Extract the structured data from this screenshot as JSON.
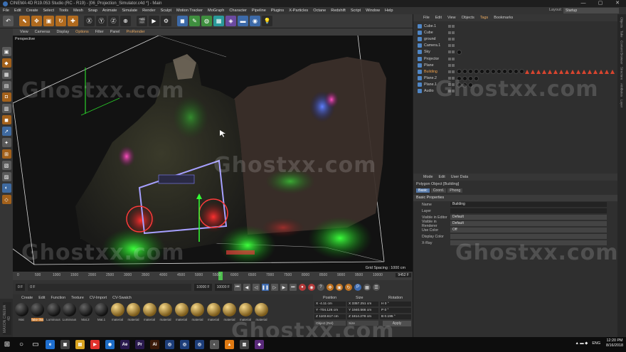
{
  "window": {
    "title": "CINEMA 4D R19.053 Studio (RC - R19) - [06_Projection_Simulator.c4d *] - Main",
    "controls": [
      "—",
      "▢",
      "✕"
    ]
  },
  "menubar": {
    "items": [
      "File",
      "Edit",
      "Create",
      "Select",
      "Tools",
      "Mesh",
      "Snap",
      "Animate",
      "Simulate",
      "Render",
      "Sculpt",
      "Motion Tracker",
      "MoGraph",
      "Character",
      "Pipeline",
      "Plugins",
      "X-Particles",
      "Octane",
      "Redshift",
      "Script",
      "Window",
      "Help"
    ],
    "layout_label": "Layout:",
    "layout_value": "Startup"
  },
  "viewport": {
    "menu": [
      "View",
      "Cameras",
      "Display",
      "Options",
      "Filter",
      "Panel",
      "ProRender"
    ],
    "label": "Perspective",
    "grid_spacing": "Grid Spacing : 1000 cm"
  },
  "timeline": {
    "ticks": [
      "0",
      "500",
      "1000",
      "1500",
      "2000",
      "2500",
      "3000",
      "3500",
      "4000",
      "4500",
      "5000",
      "5500",
      "6000",
      "6500",
      "7000",
      "7500",
      "8000",
      "8500",
      "9000",
      "9500",
      "10000"
    ],
    "end_frame": "9452 F",
    "marker_fraction": 0.565
  },
  "transport": {
    "start": "0 F",
    "current": "0 F",
    "end1": "10000 F",
    "end2": "10000 F"
  },
  "materials": {
    "menu": [
      "Create",
      "Edit",
      "Function",
      "Texture",
      "CV-Import",
      "CV-Swatch"
    ],
    "items": [
      {
        "name": "Mat",
        "type": "dark"
      },
      {
        "name": "Take this",
        "type": "dark",
        "selected": true
      },
      {
        "name": "Luminous",
        "type": "dark"
      },
      {
        "name": "Luminous",
        "type": "dark"
      },
      {
        "name": "Mat.2",
        "type": "dark"
      },
      {
        "name": "Mat.1",
        "type": "dark"
      },
      {
        "name": "material",
        "type": "gold"
      },
      {
        "name": "material",
        "type": "gold"
      },
      {
        "name": "material",
        "type": "gold"
      },
      {
        "name": "material",
        "type": "gold"
      },
      {
        "name": "material",
        "type": "gold"
      },
      {
        "name": "material",
        "type": "gold"
      },
      {
        "name": "material",
        "type": "gold"
      },
      {
        "name": "material",
        "type": "gold"
      },
      {
        "name": "material",
        "type": "gold"
      },
      {
        "name": "material",
        "type": "gold"
      }
    ]
  },
  "coords": {
    "headers": [
      "Position",
      "Size",
      "Rotation"
    ],
    "rows": [
      [
        "X  -4.11 cm",
        "X  3357.251 cm",
        "H  0 °"
      ],
      [
        "Y  -704.126 cm",
        "Y  1940.566 cm",
        "P  0 °"
      ],
      [
        "Z  1103.617 cm",
        "Z  1814.278 cm",
        "B  0.195 °"
      ]
    ],
    "mode1": "Object (Rel)",
    "mode2": "Size",
    "apply": "Apply"
  },
  "objects": {
    "menu": [
      "File",
      "Edit",
      "View",
      "Objects",
      "Tags",
      "Bookmarks"
    ],
    "items": [
      {
        "name": "Cube.1",
        "tags": []
      },
      {
        "name": "Cube",
        "tags": []
      },
      {
        "name": "ground",
        "tags": []
      },
      {
        "name": "Camera.1",
        "tags": []
      },
      {
        "name": "Sky",
        "tags": [
          "dot"
        ]
      },
      {
        "name": "Projector",
        "tags": []
      },
      {
        "name": "Plane",
        "tags": []
      },
      {
        "name": "Building",
        "selected": true,
        "tags": [
          "dot",
          "dot",
          "dot",
          "dot",
          "dot",
          "dot",
          "dot",
          "dot",
          "dot",
          "dot",
          "dot",
          "dot",
          "tri",
          "tri",
          "tri",
          "tri",
          "tri",
          "tri",
          "tri",
          "tri",
          "tri",
          "tri",
          "tri",
          "tri",
          "tri",
          "tri",
          "tri",
          "tri"
        ]
      },
      {
        "name": "Plane.2",
        "tags": [
          "dot",
          "dot",
          "dot",
          "dot"
        ]
      },
      {
        "name": "Plane.1",
        "tags": [
          "dot",
          "dot",
          "dot"
        ]
      },
      {
        "name": "Audio",
        "tags": []
      }
    ]
  },
  "attributes": {
    "menu": [
      "Mode",
      "Edit",
      "User Data"
    ],
    "title": "Polygon Object [Building]",
    "tabs": [
      "Basic",
      "Coord.",
      "Phong"
    ],
    "section": "Basic Properties",
    "rows": [
      {
        "k": "Name",
        "v": "Building"
      },
      {
        "k": "Layer",
        "v": ""
      },
      {
        "k": "Visible in Editor",
        "v": "Default"
      },
      {
        "k": "Visible in Renderer",
        "v": "Default"
      },
      {
        "k": "Use Color",
        "v": "Off"
      },
      {
        "k": "Display Color",
        "v": ""
      },
      {
        "k": "X-Ray",
        "v": ""
      }
    ]
  },
  "side_strip": [
    "Objects",
    "Take",
    "Content Browser",
    "Structure",
    "Attributes",
    "Layer"
  ],
  "watermark": "Ghostxx.com",
  "taskbar": {
    "apps": [
      {
        "label": "e",
        "color": "#1e6fd0"
      },
      {
        "label": "▣",
        "color": "#444"
      },
      {
        "label": "▤",
        "color": "#d9a420"
      },
      {
        "label": "▶",
        "color": "#e3322d"
      },
      {
        "label": "◉",
        "color": "#1d6dc5"
      },
      {
        "label": "Ae",
        "color": "#2a1a4e"
      },
      {
        "label": "Pr",
        "color": "#2a1a4e"
      },
      {
        "label": "Ai",
        "color": "#3a1a0a"
      },
      {
        "label": "◎",
        "color": "#1d3e7a"
      },
      {
        "label": "◎",
        "color": "#1d3e7a"
      },
      {
        "label": "◎",
        "color": "#1d3e7a"
      },
      {
        "label": "◐",
        "color": "#555"
      },
      {
        "label": "▲",
        "color": "#e07a12"
      },
      {
        "label": "▥",
        "color": "#444"
      },
      {
        "label": "◆",
        "color": "#5a2a7a"
      }
    ],
    "lang": "ENG",
    "time": "12:20 PM",
    "date": "8/16/2018"
  }
}
